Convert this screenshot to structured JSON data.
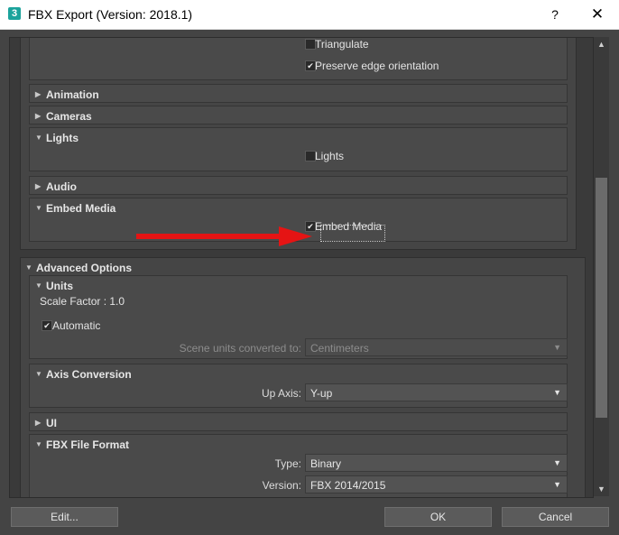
{
  "window": {
    "icon_text": "3",
    "title": "FBX Export (Version: 2018.1)",
    "help": "?",
    "close": "✕"
  },
  "geometry": {
    "triangulate": "Triangulate",
    "preserve_edge": "Preserve edge orientation"
  },
  "rollouts": {
    "animation": "Animation",
    "cameras": "Cameras",
    "lights": "Lights",
    "lights_cb": "Lights",
    "audio": "Audio",
    "embed_media": "Embed Media",
    "embed_media_cb": "Embed Media"
  },
  "advanced": {
    "title": "Advanced Options",
    "units": {
      "title": "Units",
      "scale_factor": "Scale Factor : 1.0",
      "automatic": "Automatic",
      "scene_units_label": "Scene units converted to:",
      "scene_units_value": "Centimeters"
    },
    "axis": {
      "title": "Axis Conversion",
      "up_axis_label": "Up Axis:",
      "up_axis_value": "Y-up"
    },
    "ui": {
      "title": "UI"
    },
    "fbx_format": {
      "title": "FBX File Format",
      "type_label": "Type:",
      "type_value": "Binary",
      "version_label": "Version:",
      "version_value": "FBX 2014/2015"
    }
  },
  "buttons": {
    "edit": "Edit...",
    "ok": "OK",
    "cancel": "Cancel"
  },
  "icons": {
    "expanded": "▼",
    "collapsed": "▶",
    "dropdown": "▼",
    "scroll_up": "▲",
    "scroll_down": "▼",
    "checkmark": "✔"
  },
  "colors": {
    "annotation_arrow": "#e51414",
    "app_icon": "#1ba39c"
  }
}
